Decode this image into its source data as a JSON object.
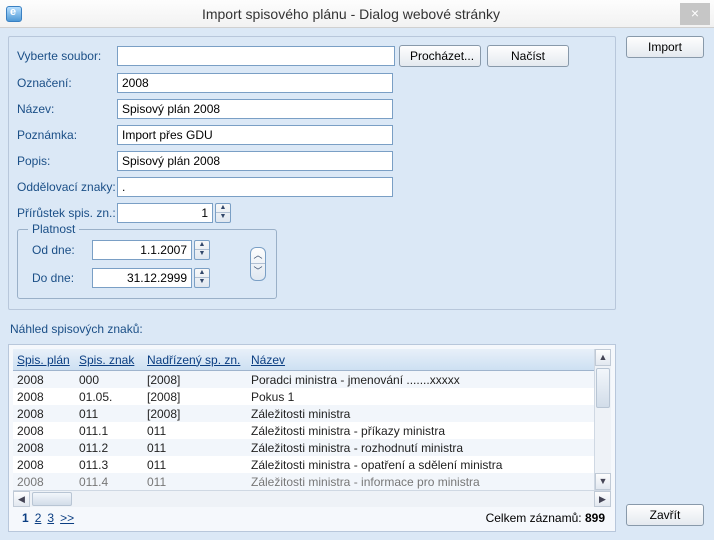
{
  "window": {
    "title": "Import spisového plánu - Dialog webové stránky"
  },
  "buttons": {
    "browse": "Procházet...",
    "load": "Načíst",
    "import": "Import",
    "close": "Zavřít"
  },
  "labels": {
    "select_file": "Vyberte soubor:",
    "code": "Označení:",
    "name": "Název:",
    "note": "Poznámka:",
    "desc": "Popis:",
    "separators": "Oddělovací znaky:",
    "increment": "Přírůstek spis. zn.:",
    "validity": "Platnost",
    "from": "Od dne:",
    "to": "Do dne:",
    "preview": "Náhled spisových znaků:",
    "total_records": "Celkem záznamů:"
  },
  "fields": {
    "file": "",
    "code": "2008",
    "name": "Spisový plán 2008",
    "note": "Import přes GDU",
    "desc": "Spisový plán 2008",
    "separators": ".",
    "increment": "1",
    "from": "1.1.2007",
    "to": "31.12.2999"
  },
  "grid": {
    "headers": {
      "plan": "Spis. plán",
      "mark": "Spis. znak",
      "parent": "Nadřízený sp. zn.",
      "name": "Název"
    },
    "rows": [
      {
        "plan": "2008",
        "mark": "000",
        "parent": "[2008]",
        "name": "Poradci ministra - jmenování .......xxxxx"
      },
      {
        "plan": "2008",
        "mark": "01.05.",
        "parent": "[2008]",
        "name": "Pokus 1"
      },
      {
        "plan": "2008",
        "mark": "011",
        "parent": "[2008]",
        "name": "Záležitosti ministra"
      },
      {
        "plan": "2008",
        "mark": "011.1",
        "parent": "011",
        "name": "Záležitosti ministra - příkazy ministra"
      },
      {
        "plan": "2008",
        "mark": "011.2",
        "parent": "011",
        "name": "Záležitosti ministra - rozhodnutí ministra"
      },
      {
        "plan": "2008",
        "mark": "011.3",
        "parent": "011",
        "name": "Záležitosti ministra - opatření a sdělení ministra"
      },
      {
        "plan": "2008",
        "mark": "011.4",
        "parent": "011",
        "name": "Záležitosti ministra - informace pro ministra"
      }
    ],
    "total": "899",
    "pages": [
      "1",
      "2",
      "3"
    ],
    "current_page": "1",
    "more": ">>"
  }
}
